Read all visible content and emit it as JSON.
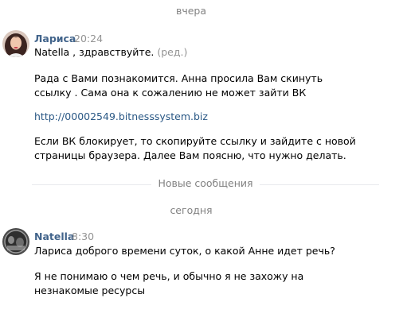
{
  "separators": {
    "yesterday": "вчера",
    "new_messages": "Новые сообщения",
    "today": "сегодня"
  },
  "messages": [
    {
      "author": "Лариса",
      "time": "20:24",
      "avatar_icon": "woman-portrait-avatar",
      "greeting_text": "Natella , здравствуйте.",
      "edited_label": "(ред.)",
      "paragraph_1": [
        "Рада с Вами познакомится. Анна просила Вам скинуть",
        "ссылку . Сама она к сожалению не может зайти ВК"
      ],
      "link": "http://00002549.bitnesssystem.biz",
      "paragraph_2": [
        "Если ВК блокирует, то скопируйте ссылку и зайдите с новой",
        "страницы браузера. Далее Вам поясню, что нужно делать."
      ]
    },
    {
      "author": "Natella",
      "time": "8:30",
      "avatar_icon": "dark-photo-avatar",
      "line_1": "Лариса доброго времени суток, о какой Анне идет речь?",
      "paragraph_2": [
        "Я не понимаю о чем речь, и обычно я не захожу на",
        "незнакомые ресурсы"
      ]
    }
  ],
  "colors": {
    "author": "#42648b",
    "link": "#2a5885",
    "meta": "#939393",
    "separator_text": "#828282",
    "separator_line": "#e7e8ec"
  }
}
